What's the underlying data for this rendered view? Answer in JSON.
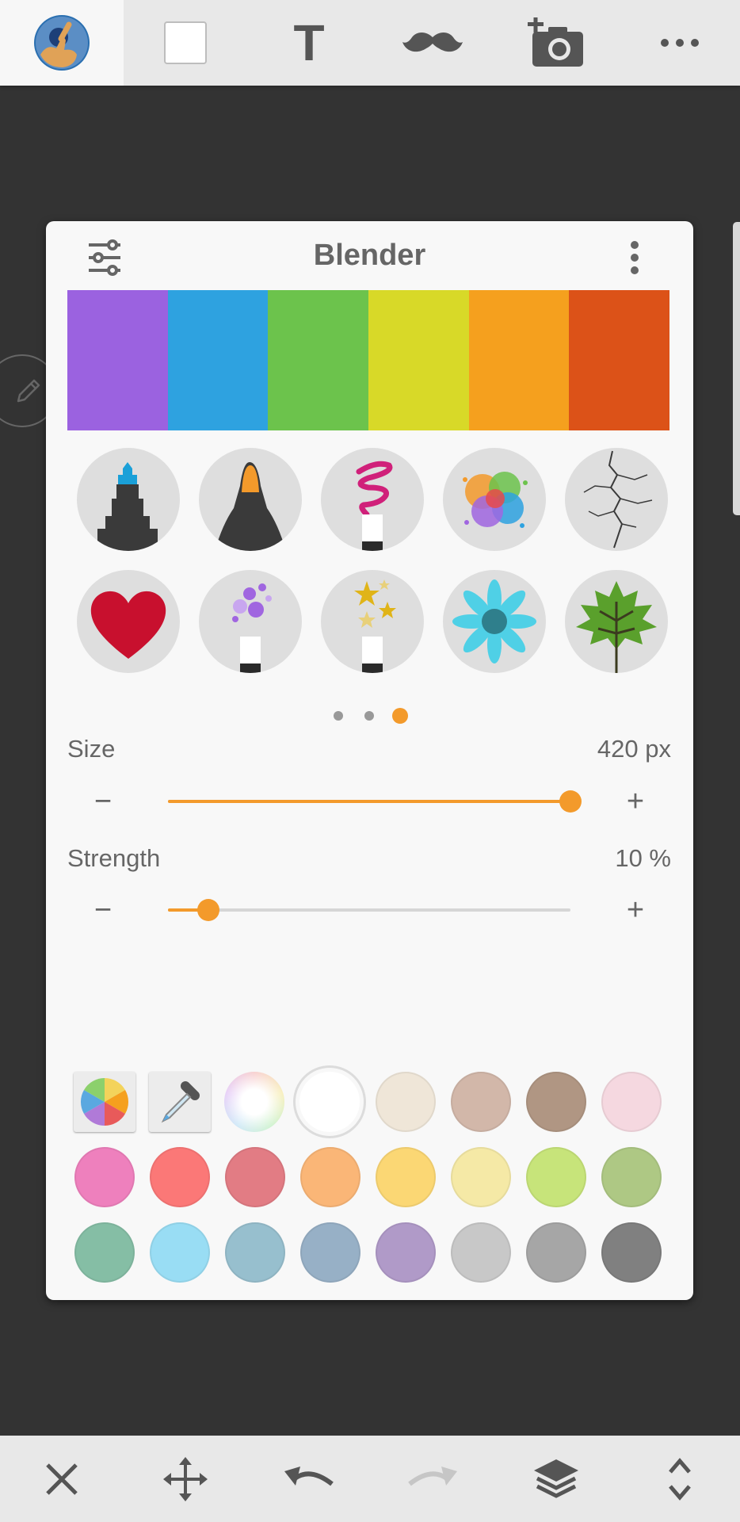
{
  "toolbar": {
    "items": [
      {
        "icon": "brush-tool-icon",
        "active": true
      },
      {
        "icon": "shape-icon"
      },
      {
        "icon": "text-icon",
        "glyph": "T"
      },
      {
        "icon": "mustache-sticker-icon"
      },
      {
        "icon": "add-photo-icon"
      },
      {
        "icon": "more-icon"
      }
    ]
  },
  "panel": {
    "title": "Blender",
    "gradient_colors": [
      "#9b62e0",
      "#2ea2e0",
      "#6cc34c",
      "#d8d928",
      "#f5a01e",
      "#dc5218"
    ],
    "brushes": [
      {
        "name": "marker-tip-brush",
        "accent": "#1aa0d8"
      },
      {
        "name": "felt-pen-brush",
        "accent": "#f39a2b"
      },
      {
        "name": "squiggle-brush",
        "accent": "#d0207a"
      },
      {
        "name": "color-splash-brush"
      },
      {
        "name": "crack-brush"
      },
      {
        "name": "heart-stamp-brush",
        "accent": "#c8102e"
      },
      {
        "name": "bubbles-brush",
        "accent": "#a066e0"
      },
      {
        "name": "stars-brush",
        "accent": "#e0b418"
      },
      {
        "name": "flower-stamp-brush",
        "accent": "#4fd0e6"
      },
      {
        "name": "leaf-stamp-brush",
        "accent": "#5aa02c"
      }
    ],
    "pager": {
      "count": 3,
      "active_index": 2
    }
  },
  "size": {
    "label": "Size",
    "value_text": "420 px",
    "fraction": 1.0
  },
  "strength": {
    "label": "Strength",
    "value_text": "10 %",
    "fraction": 0.1
  },
  "slider_controls": {
    "minus": "−",
    "plus": "+"
  },
  "palette": {
    "tools": [
      "color-wheel",
      "eyedropper",
      "rainbow",
      "white"
    ],
    "colors": [
      "#efe6d8",
      "#d2b7a9",
      "#b09683",
      "#f5d8e0",
      "#ee80bd",
      "#fb7877",
      "#e27c84",
      "#fab677",
      "#fbd774",
      "#f5e9a6",
      "#c7e47a",
      "#aec884",
      "#85bea5",
      "#99ddf4",
      "#97bfce",
      "#97b0c6",
      "#b09ac8",
      "#c8c8c8",
      "#a6a6a6",
      "#808080"
    ]
  },
  "bottombar": {
    "items": [
      "close-icon",
      "move-icon",
      "undo-icon",
      "redo-icon",
      "layers-icon",
      "expand-icon"
    ]
  },
  "colors": {
    "accent": "#f39a2b",
    "panel_bg": "#f8f8f8",
    "canvas_bg": "#333333",
    "bar_bg": "#e8e8e8"
  }
}
